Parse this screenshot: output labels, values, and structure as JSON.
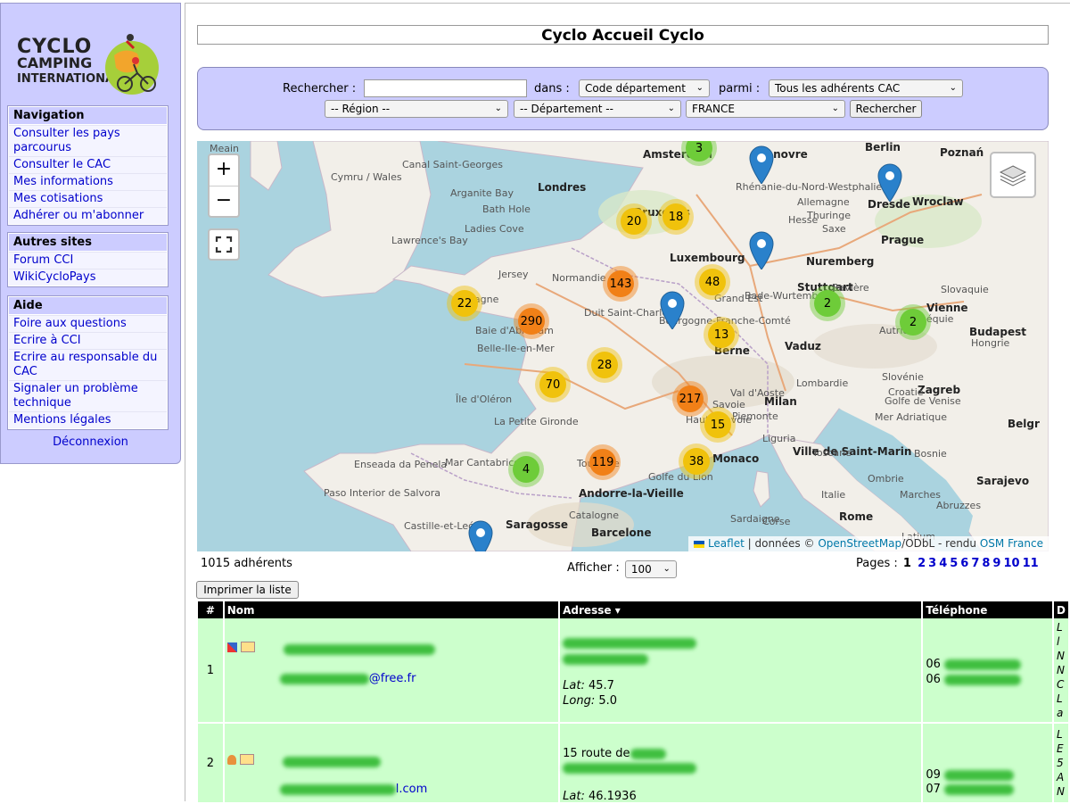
{
  "logo": {
    "line1": "CYCLO",
    "line2": "CAMPING",
    "line3": "INTERNATIONAL"
  },
  "sidebar": {
    "navigation": {
      "title": "Navigation",
      "items": [
        "Consulter les pays parcourus",
        "Consulter le CAC",
        "Mes informations",
        "Mes cotisations",
        "Adhérer ou m'abonner"
      ]
    },
    "autres": {
      "title": "Autres sites",
      "items": [
        "Forum CCI",
        "WikiCycloPays"
      ]
    },
    "aide": {
      "title": "Aide",
      "items": [
        "Foire aux questions",
        "Ecrire à CCI",
        "Ecrire au responsable du CAC",
        "Signaler un problème technique",
        "Mentions légales"
      ]
    },
    "logout": "Déconnexion"
  },
  "page_title": "Cyclo Accueil Cyclo",
  "search": {
    "label_search": "Rechercher :",
    "label_in": "dans :",
    "in_value": "Code département",
    "label_among": "parmi :",
    "among_value": "Tous les adhérents CAC",
    "region_value": "-- Région --",
    "departement_value": "-- Département --",
    "country_value": "FRANCE",
    "submit": "Rechercher"
  },
  "map": {
    "clusters": [
      {
        "n": "3",
        "c": "green"
      },
      {
        "n": "20",
        "c": "yellow"
      },
      {
        "n": "18",
        "c": "yellow"
      },
      {
        "n": "143",
        "c": "orange"
      },
      {
        "n": "22",
        "c": "yellow"
      },
      {
        "n": "290",
        "c": "orange"
      },
      {
        "n": "48",
        "c": "yellow"
      },
      {
        "n": "2",
        "c": "green"
      },
      {
        "n": "2",
        "c": "green"
      },
      {
        "n": "13",
        "c": "yellow"
      },
      {
        "n": "28",
        "c": "yellow"
      },
      {
        "n": "70",
        "c": "yellow"
      },
      {
        "n": "217",
        "c": "orange"
      },
      {
        "n": "15",
        "c": "yellow"
      },
      {
        "n": "4",
        "c": "green"
      },
      {
        "n": "119",
        "c": "orange"
      },
      {
        "n": "38",
        "c": "yellow"
      }
    ],
    "places_major": [
      "Amsterdam",
      "Londres",
      "Bruxelles",
      "Luxembourg",
      "Prague",
      "Vienne",
      "Budapest",
      "Berne",
      "Zagreb",
      "Milan",
      "Ville de Saint-Marin",
      "Monaco",
      "Sarajevo",
      "Rome",
      "Andorre-la-Vieille",
      "Saragosse",
      "Barcelone",
      "Nuremberg",
      "Stuttgart",
      "Dresde",
      "Wroclaw",
      "Hanovre",
      "Poznań",
      "Berlin",
      "Vaduz",
      "Belgr"
    ],
    "places_minor": [
      "Meain",
      "Canal Saint-Georges",
      "Cymru / Wales",
      "Arganite Bay",
      "Ladies Cove",
      "Lawrence's Bay",
      "Bath Hole",
      "Jersey",
      "Bretagne",
      "Baie d'Abraham",
      "Belle-Ile-en-Mer",
      "Île d'Oléron",
      "La Petite Gironde",
      "Enseada da Penela",
      "Mar Cantabrico",
      "Paso Interior de Salvora",
      "Castille-et-León",
      "Golfe du Lion",
      "Toulouse",
      "Catalogne",
      "Normandie",
      "Duit Saint-Charles",
      "Bourgogne-Franche-Comté",
      "Grand Est",
      "Bade-Wurtemberg",
      "Bavière",
      "Autriche",
      "Slovaquie",
      "Hongrie",
      "Slovénie",
      "Croatie",
      "Bosnie",
      "Italie",
      "Toscane",
      "Ombrie",
      "Marches",
      "Abruzzes",
      "Latium",
      "Sardaigne",
      "Corse",
      "Liguria",
      "Piemonte",
      "Lombardie",
      "Haute-Savoie",
      "Savoie",
      "Val d'Aoste",
      "Golfe de Venise",
      "Rhénanie-du-Nord-Westphalie",
      "Hesse",
      "Thuringe",
      "Saxe",
      "Allemagne",
      "Tchéquie",
      "Mer Adriatique"
    ],
    "attribution": {
      "leaflet": "Leaflet",
      "donnees": "| données ©",
      "osm": "OpenStreetMap",
      "odbl": "/ODbL - rendu",
      "osmfr": "OSM France"
    }
  },
  "results": {
    "count": "1015 adhérents",
    "show_label": "Afficher :",
    "show_value": "100",
    "pages_label": "Pages :",
    "current_page": "1",
    "pages": [
      "2",
      "3",
      "4",
      "5",
      "6",
      "7",
      "8",
      "9",
      "10",
      "11"
    ],
    "print_button": "Imprimer la liste"
  },
  "table": {
    "headers": [
      "#",
      "Nom",
      "Adresse",
      "Téléphone",
      "D"
    ],
    "rows": [
      {
        "num": "1",
        "email_suffix": "@free.fr",
        "lat_label": "Lat:",
        "lat_value": "45.7",
        "long_label": "Long:",
        "long_value": "5.0",
        "phone1": "06",
        "phone2": "06",
        "dispo": [
          "L",
          "l",
          "N",
          "N",
          "C",
          "L",
          "a"
        ]
      },
      {
        "num": "2",
        "email_suffix": "l.com",
        "address_start": "15 route de",
        "lat_label": "Lat:",
        "lat_value": "46.1936",
        "phone1": "09",
        "phone2": "07",
        "dispo": [
          "L",
          "E",
          "5",
          "A",
          "N"
        ]
      }
    ]
  },
  "colors": {
    "sidebar": "#ccccff",
    "search_bg": "#ccccff",
    "row_bg": "#ccffcc",
    "header_bg": "#000000",
    "link": "#0000cc"
  }
}
